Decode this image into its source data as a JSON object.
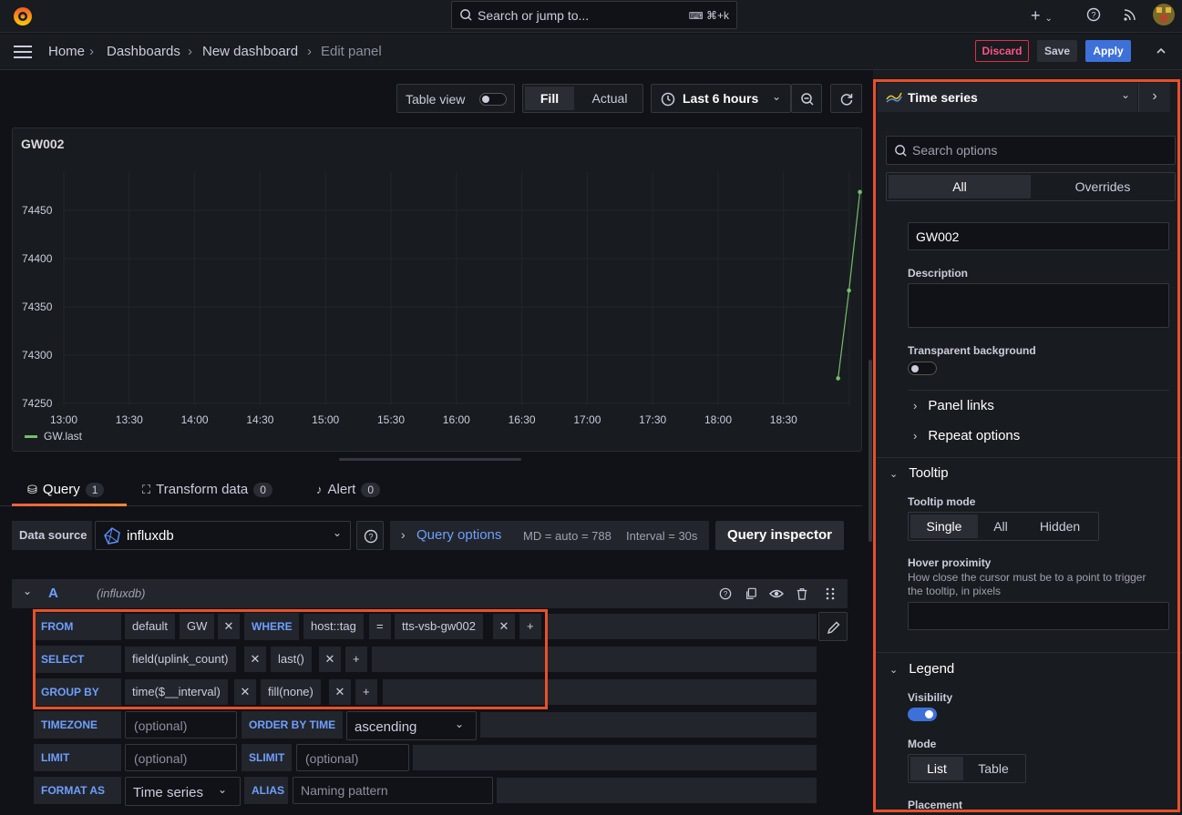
{
  "topbar": {
    "search_placeholder": "Search or jump to...",
    "search_shortcut": "⌘+k"
  },
  "breadcrumb": [
    "Home",
    "Dashboards",
    "New dashboard",
    "Edit panel"
  ],
  "actions": {
    "discard": "Discard",
    "save": "Save",
    "apply": "Apply"
  },
  "panel_toolbar": {
    "table_view": "Table view",
    "fill": "Fill",
    "actual": "Actual",
    "time_range": "Last 6 hours"
  },
  "panel": {
    "title": "GW002",
    "legend": "GW.last",
    "series_color": "#73bf69"
  },
  "chart_data": {
    "type": "line",
    "title": "GW002",
    "x_ticks": [
      "13:00",
      "13:30",
      "14:00",
      "14:30",
      "15:00",
      "15:30",
      "16:00",
      "16:30",
      "17:00",
      "17:30",
      "18:00",
      "18:30"
    ],
    "y_ticks": [
      "74450",
      "74400",
      "74350",
      "74300",
      "74250"
    ],
    "ylim": [
      74250,
      74450
    ],
    "series": [
      {
        "name": "GW.last",
        "x": [
          "18:55",
          "19:00",
          "19:05"
        ],
        "values": [
          74276,
          74367,
          74469
        ]
      }
    ]
  },
  "query_tabs": {
    "query": {
      "label": "Query",
      "count": "1"
    },
    "transform": {
      "label": "Transform data",
      "count": "0"
    },
    "alert": {
      "label": "Alert",
      "count": "0"
    }
  },
  "datasource": {
    "label": "Data source",
    "value": "influxdb",
    "query_options": "Query options",
    "md": "MD = auto = 788",
    "interval": "Interval = 30s",
    "inspector": "Query inspector"
  },
  "query": {
    "ref": "A",
    "source": "(influxdb)",
    "from_kw": "FROM",
    "from_db": "default",
    "from_measure": "GW",
    "where_kw": "WHERE",
    "where_key": "host::tag",
    "where_op": "=",
    "where_val": "tts-vsb-gw002",
    "select_kw": "SELECT",
    "select_field": "field(uplink_count)",
    "select_fn": "last()",
    "group_kw": "GROUP BY",
    "group_time": "time($__interval)",
    "group_fill": "fill(none)",
    "timezone_kw": "TIMEZONE",
    "timezone_ph": "(optional)",
    "orderby_kw": "ORDER BY TIME",
    "orderby_val": "ascending",
    "limit_kw": "LIMIT",
    "limit_ph": "(optional)",
    "slimit_kw": "SLIMIT",
    "slimit_ph": "(optional)",
    "format_kw": "FORMAT AS",
    "format_val": "Time series",
    "alias_kw": "ALIAS",
    "alias_ph": "Naming pattern"
  },
  "options": {
    "viz": "Time series",
    "search_ph": "Search options",
    "tab_all": "All",
    "tab_overrides": "Overrides",
    "title_value": "GW002",
    "description_label": "Description",
    "transparent_label": "Transparent background",
    "panel_links": "Panel links",
    "repeat_options": "Repeat options",
    "tooltip": "Tooltip",
    "tooltip_mode": "Tooltip mode",
    "tooltip_single": "Single",
    "tooltip_all": "All",
    "tooltip_hidden": "Hidden",
    "hover_label": "Hover proximity",
    "hover_desc": "How close the cursor must be to a point to trigger the tooltip, in pixels",
    "legend": "Legend",
    "visibility": "Visibility",
    "mode": "Mode",
    "mode_list": "List",
    "mode_table": "Table",
    "placement": "Placement"
  }
}
